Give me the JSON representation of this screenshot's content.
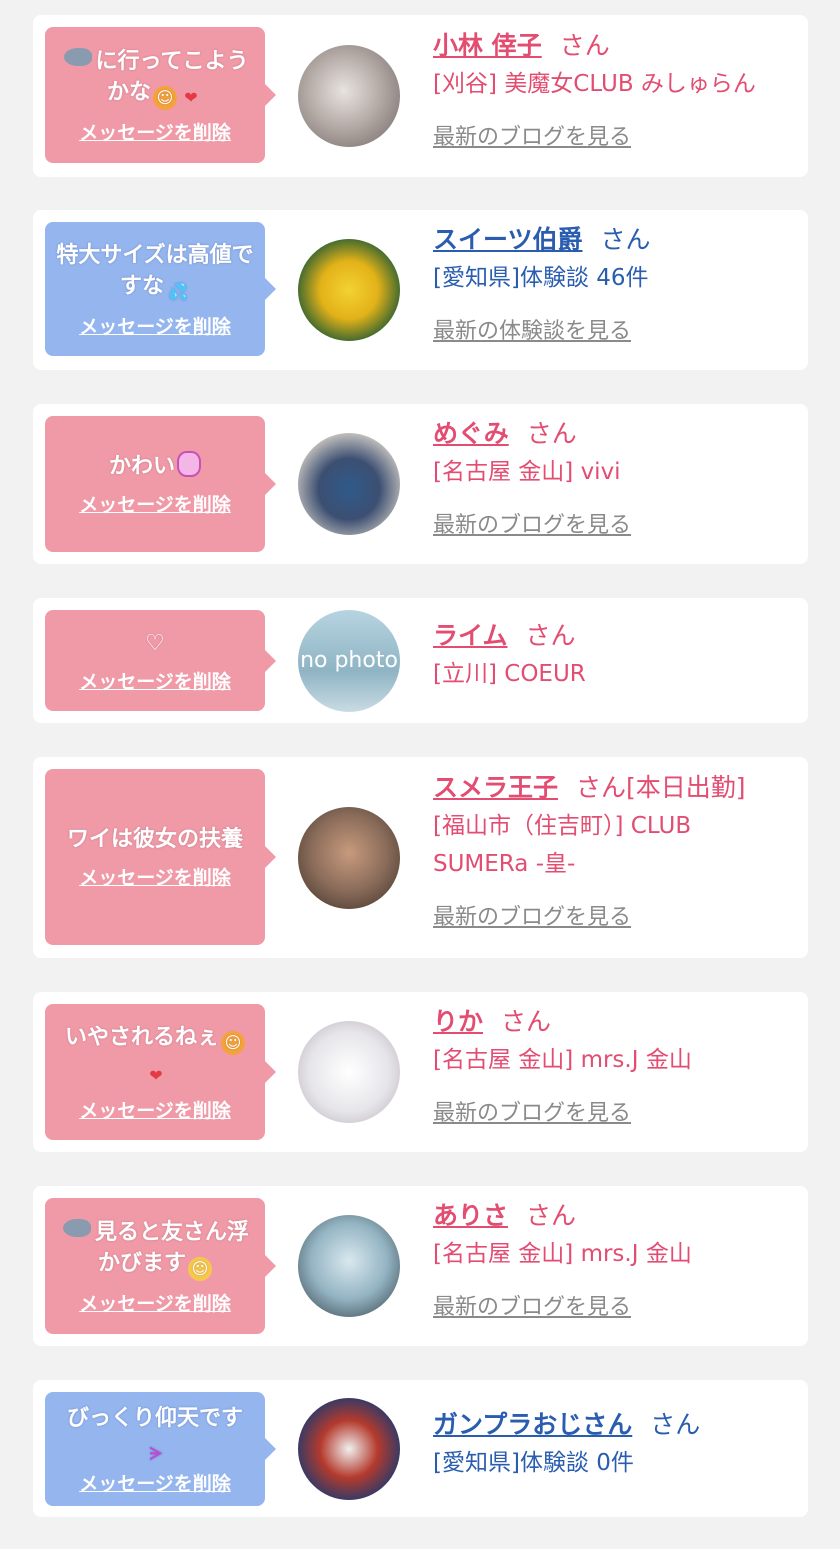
{
  "delete_label": "メッセージを削除",
  "san_label": "さん",
  "entries": [
    {
      "message": "に行ってこようかな",
      "emojis": [
        "shark-emoji",
        "smile-emoji",
        "heart-emoji"
      ],
      "name": "小林 倖子",
      "suffix": "さん",
      "shop": "[刈谷] 美魔女CLUB みしゅらん",
      "link": "最新のブログを見る",
      "theme": "pink"
    },
    {
      "message": "特大サイズは高値ですな",
      "emojis": [
        "sweat-emoji"
      ],
      "name": "スイーツ伯爵",
      "suffix": "さん",
      "shop": "[愛知県]体験談 46件",
      "link": "最新の体験談を見る",
      "theme": "blue"
    },
    {
      "message": "かわい",
      "emojis": [
        "rabbit-emoji"
      ],
      "name": "めぐみ",
      "suffix": "さん",
      "shop": "[名古屋 金山] vivi",
      "link": "最新のブログを見る",
      "theme": "pink"
    },
    {
      "message": "♡",
      "emojis": [],
      "name": "ライム",
      "suffix": "さん",
      "shop": "[立川] COEUR",
      "link": "",
      "avatar_text": "no photo",
      "theme": "pink"
    },
    {
      "message": "ワイは彼女の扶養",
      "emojis": [],
      "name": "スメラ王子",
      "suffix": "さん[本日出勤]",
      "shop": "[福山市（住吉町）] CLUB SUMERa -皇-",
      "link": "最新のブログを見る",
      "theme": "pink"
    },
    {
      "message": "いやされるねぇ",
      "emojis": [
        "smile-emoji",
        "heart-emoji"
      ],
      "name": "りか",
      "suffix": "さん",
      "shop": "[名古屋 金山] mrs.J 金山",
      "link": "最新のブログを見る",
      "theme": "pink"
    },
    {
      "message": "見ると友さん浮かびます",
      "emojis": [
        "shark-emoji",
        "blush-emoji"
      ],
      "name": "ありさ",
      "suffix": "さん",
      "shop": "[名古屋 金山] mrs.J 金山",
      "link": "最新のブログを見る",
      "theme": "pink"
    },
    {
      "message": "びっくり仰天です",
      "emojis": [
        "shocked-emoji"
      ],
      "name": "ガンプラおじさん",
      "suffix": "さん",
      "shop": "[愛知県]体験談 0件",
      "link": "",
      "theme": "blue"
    }
  ],
  "colors": {
    "pink_bubble": "#f09aa8",
    "blue_bubble": "#95b5ef",
    "pink_text": "#e24d71",
    "blue_text": "#2a5db0",
    "link_gray": "#8a8a8a",
    "background": "#f2f2f2"
  }
}
